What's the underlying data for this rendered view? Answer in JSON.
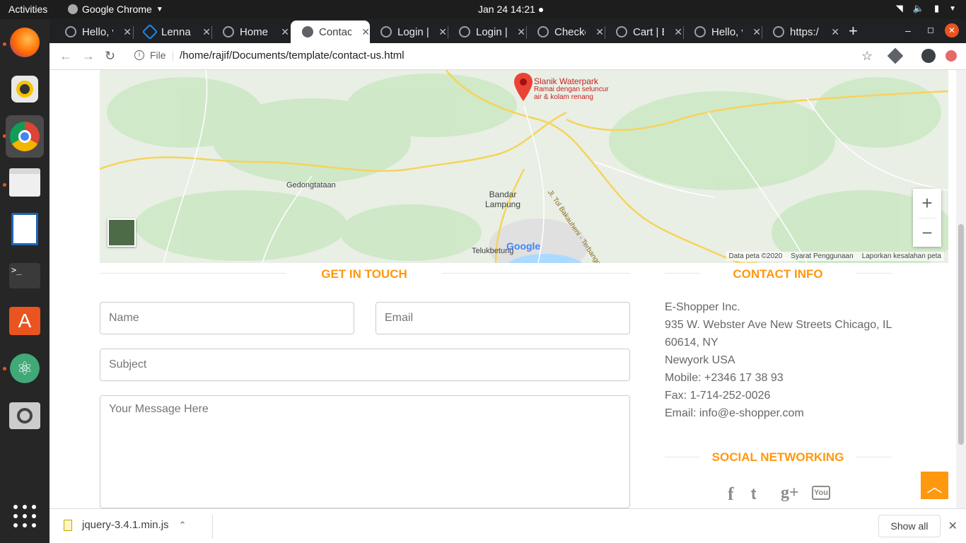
{
  "topbar": {
    "activities": "Activities",
    "app_name": "Google Chrome",
    "clock": "Jan 24  14:21"
  },
  "tabs": [
    {
      "label": "Hello, v"
    },
    {
      "label": "Lenna"
    },
    {
      "label": "Home |"
    },
    {
      "label": "Contac",
      "active": true
    },
    {
      "label": "Login |"
    },
    {
      "label": "Login |"
    },
    {
      "label": "Checko"
    },
    {
      "label": "Cart | E"
    },
    {
      "label": "Hello, v"
    },
    {
      "label": "https:/"
    }
  ],
  "addressbar": {
    "info_label": "File",
    "url": "/home/rajif/Documents/template/contact-us.html"
  },
  "map": {
    "pin_title": "Slanik Waterpark",
    "pin_subtitle_1": "Ramai dengan seluncur",
    "pin_subtitle_2": "air & kolam renang",
    "place_1": "Gedongtataan",
    "city_line_1": "Bandar",
    "city_line_2": "Lampung",
    "place_2": "Telukbetung",
    "road": "Jl. Tol Bakauheni - Terbanggi Besar",
    "logo": "Google",
    "footer_data": "Data peta ©2020",
    "footer_terms": "Syarat Penggunaan",
    "footer_report": "Laporkan kesalahan peta",
    "zoom_in": "+",
    "zoom_out": "−"
  },
  "contact_form": {
    "title": "GET IN TOUCH",
    "name_placeholder": "Name",
    "email_placeholder": "Email",
    "subject_placeholder": "Subject",
    "message_placeholder": "Your Message Here"
  },
  "contact_info": {
    "title": "CONTACT INFO",
    "lines": [
      "E-Shopper Inc.",
      "935 W. Webster Ave New Streets Chicago, IL",
      "60614, NY",
      "Newyork USA",
      "Mobile: +2346 17 38 93",
      "Fax: 1-714-252-0026",
      "Email: info@e-shopper.com"
    ]
  },
  "social": {
    "title": "SOCIAL NETWORKING",
    "facebook": "f",
    "twitter": "t",
    "googleplus": "g+",
    "youtube": "You"
  },
  "downloads": {
    "filename": "jquery-3.4.1.min.js",
    "show_all": "Show all"
  },
  "colors": {
    "accent": "#fe980f"
  }
}
